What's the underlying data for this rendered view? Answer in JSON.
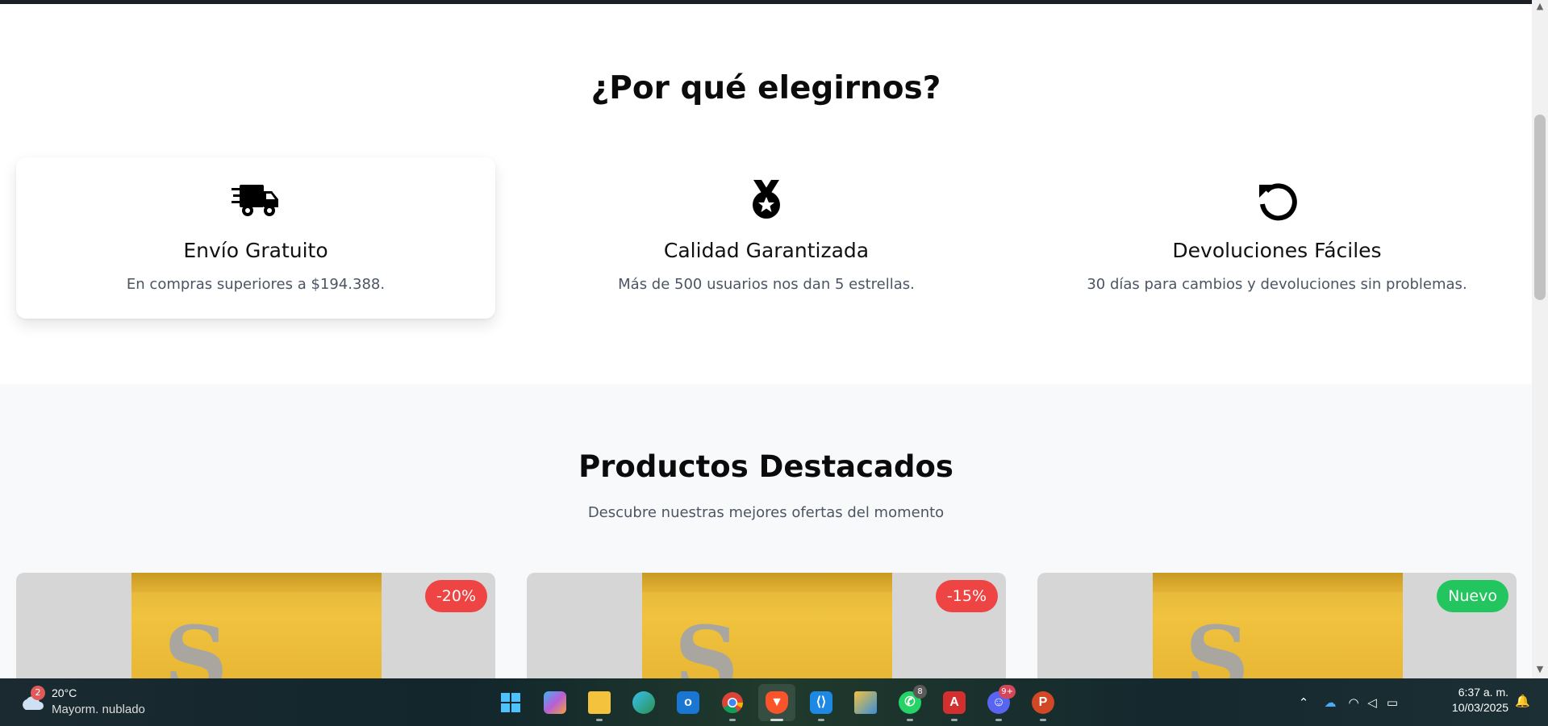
{
  "why_section": {
    "title": "¿Por qué elegirnos?",
    "features": [
      {
        "icon": "truck-fast-icon",
        "title": "Envío Gratuito",
        "description": "En compras superiores a $194.388."
      },
      {
        "icon": "medal-icon",
        "title": "Calidad Garantizada",
        "description": "Más de 500 usuarios nos dan 5 estrellas."
      },
      {
        "icon": "rotate-left-icon",
        "title": "Devoluciones Fáciles",
        "description": "30 días para cambios y devoluciones sin problemas."
      }
    ]
  },
  "products_section": {
    "title": "Productos Destacados",
    "subtitle": "Descubre nuestras mejores ofertas del momento",
    "products": [
      {
        "badge": "-20%",
        "badge_color": "#ef4444",
        "bag_letter": "S"
      },
      {
        "badge": "-15%",
        "badge_color": "#ef4444",
        "bag_letter": "S"
      },
      {
        "badge": "Nuevo",
        "badge_color": "#22c55e",
        "bag_letter": "S"
      }
    ]
  },
  "taskbar": {
    "weather": {
      "badge": "2",
      "temp": "20°C",
      "desc": "Mayorm. nublado"
    },
    "apps": [
      {
        "name": "start-icon"
      },
      {
        "name": "copilot-icon"
      },
      {
        "name": "file-explorer-icon"
      },
      {
        "name": "edge-icon"
      },
      {
        "name": "outlook-icon"
      },
      {
        "name": "chrome-icon"
      },
      {
        "name": "brave-icon"
      },
      {
        "name": "vscode-icon"
      },
      {
        "name": "files-icon"
      },
      {
        "name": "whatsapp-icon",
        "count": "8"
      },
      {
        "name": "acrobat-icon"
      },
      {
        "name": "discord-icon",
        "count": "9+"
      },
      {
        "name": "powerpoint-icon"
      }
    ],
    "clock": {
      "time": "6:37 a. m.",
      "date": "10/03/2025"
    }
  },
  "colors": {
    "accent_red": "#ef4444",
    "accent_green": "#22c55e",
    "bag_yellow": "#f0c23e"
  }
}
